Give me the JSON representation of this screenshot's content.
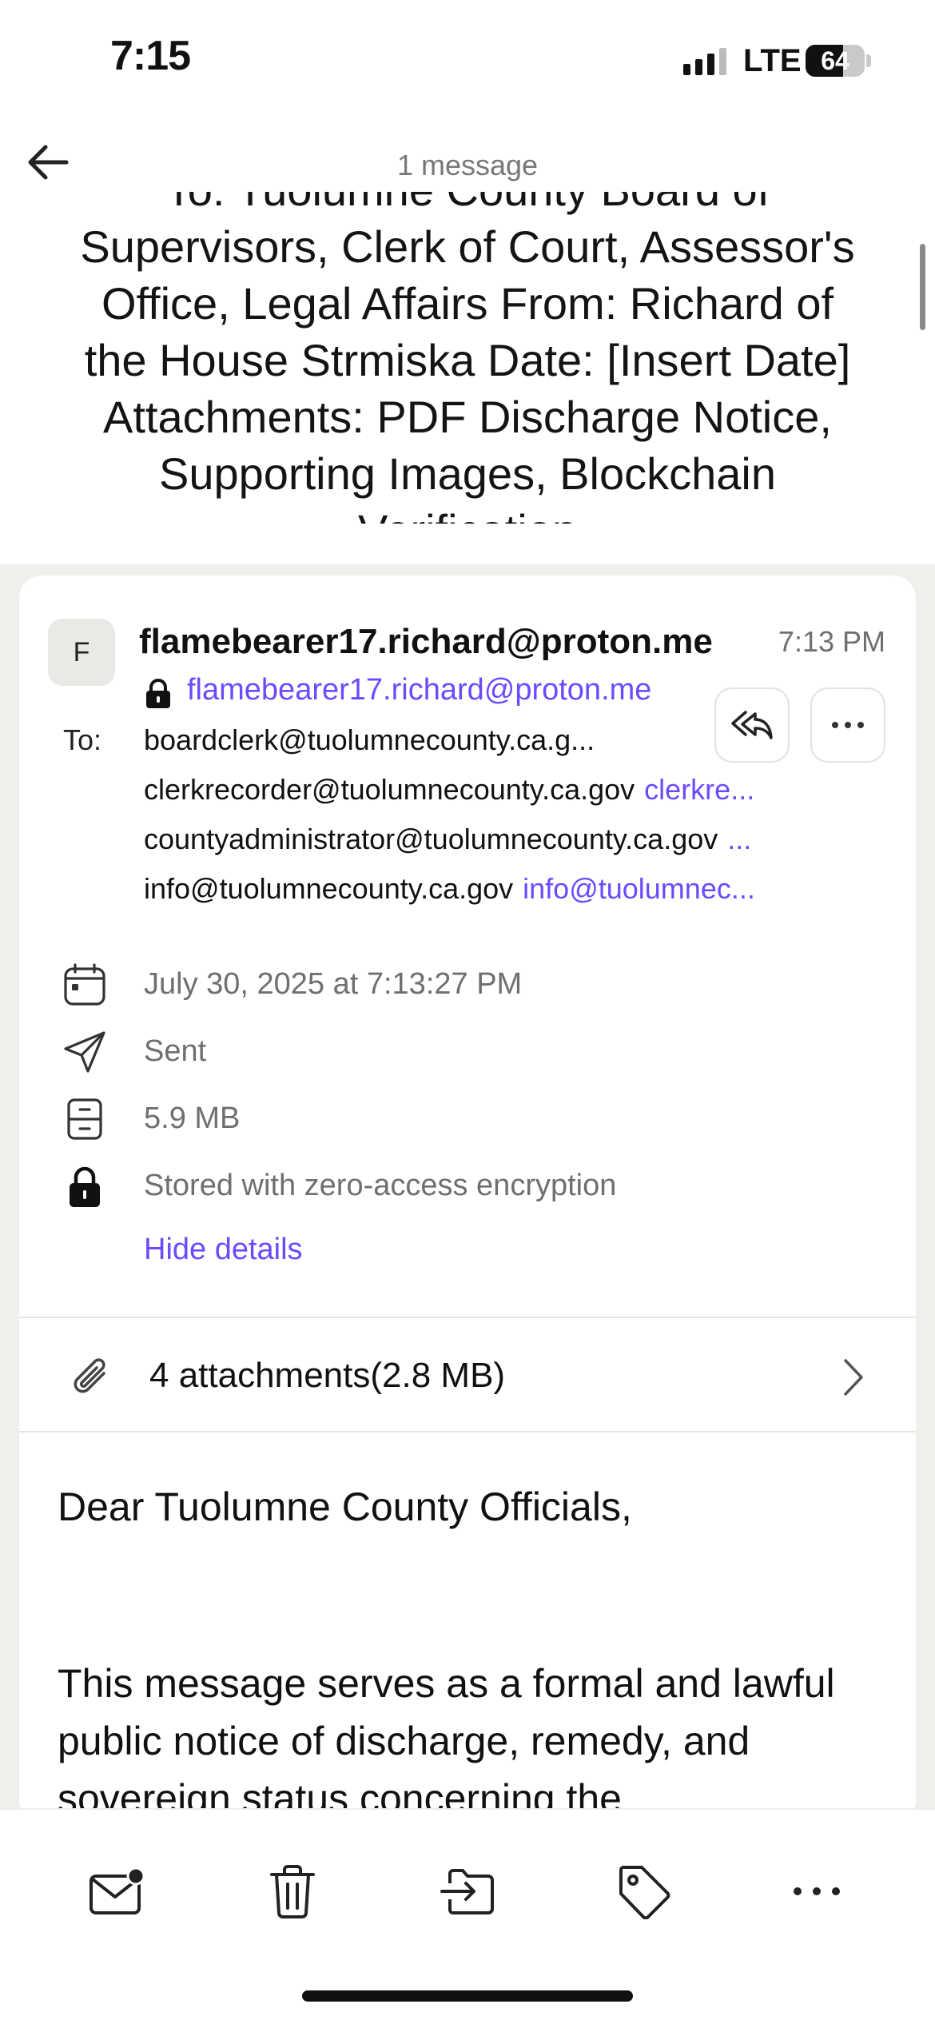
{
  "status_bar": {
    "time": "7:15",
    "network": "LTE",
    "battery_level": "64",
    "battery_fraction": 0.64,
    "signal_bars_active": 3,
    "signal_bars_total": 4
  },
  "header": {
    "message_count": "1 message"
  },
  "subject": {
    "text": "To: Tuolumne County Board of Supervisors, Clerk of Court, Assessor's Office, Legal Affairs From: Richard of the House Strmiska Date: [Insert Date] Attachments: PDF Discharge Notice, Supporting Images, Blockchain Verification"
  },
  "message": {
    "avatar_initial": "F",
    "sender_name": "flamebearer17.richard@proton.me",
    "sent_time": "7:13 PM",
    "sender_address": "flamebearer17.richard@proton.me",
    "to_label": "To:",
    "recipients": [
      {
        "address": "boardclerk@tuolumnecounty.ca.g...",
        "alias": ""
      },
      {
        "address": "clerkrecorder@tuolumnecounty.ca.gov",
        "alias": "clerkre..."
      },
      {
        "address": "countyadministrator@tuolumnecounty.ca.gov",
        "alias": "..."
      },
      {
        "address": "info@tuolumnecounty.ca.gov",
        "alias": "info@tuolumnec..."
      }
    ],
    "details": {
      "date": "July 30, 2025 at 7:13:27 PM",
      "folder": "Sent",
      "size": "5.9 MB",
      "encryption": "Stored with zero-access encryption",
      "hide_details_label": "Hide details"
    },
    "attachments_label": "4 attachments(2.8 MB)",
    "body": {
      "greeting": "Dear Tuolumne County Officials,",
      "paragraph": "This message serves as a formal and lawful public notice of discharge, remedy, and sovereign status concerning the"
    }
  },
  "colors": {
    "accent": "#6d4aff",
    "muted_text": "#6f6f6f",
    "background_band": "#f1efec"
  },
  "icons": {
    "back": "arrow-left-icon",
    "lock": "lock-icon",
    "reply_all": "reply-all-icon",
    "more": "ellipsis-icon",
    "calendar": "calendar-icon",
    "sent": "paper-plane-icon",
    "size": "archive-icon",
    "attachment": "paperclip-icon",
    "chevron": "chevron-right-icon",
    "unread": "envelope-dot-icon",
    "trash": "trash-icon",
    "move": "move-to-folder-icon",
    "label": "tag-icon"
  }
}
